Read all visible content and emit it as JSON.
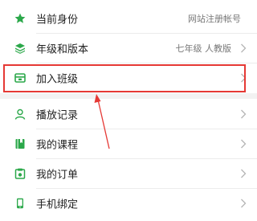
{
  "colors": {
    "icon_green": "#2ba84a",
    "annotation_red": "#e53935"
  },
  "menu_group_1": [
    {
      "label": "当前身份",
      "value": "网站注册帐号",
      "icon": "star-icon"
    },
    {
      "label": "年级和版本",
      "value": "七年级 人教版",
      "icon": "layers-icon"
    },
    {
      "label": "加入班级",
      "value": "",
      "icon": "class-board-icon"
    }
  ],
  "menu_group_2": [
    {
      "label": "播放记录",
      "icon": "user-icon"
    },
    {
      "label": "我的课程",
      "icon": "book-icon"
    },
    {
      "label": "我的订单",
      "icon": "order-icon"
    },
    {
      "label": "手机绑定",
      "icon": "phone-icon"
    }
  ]
}
